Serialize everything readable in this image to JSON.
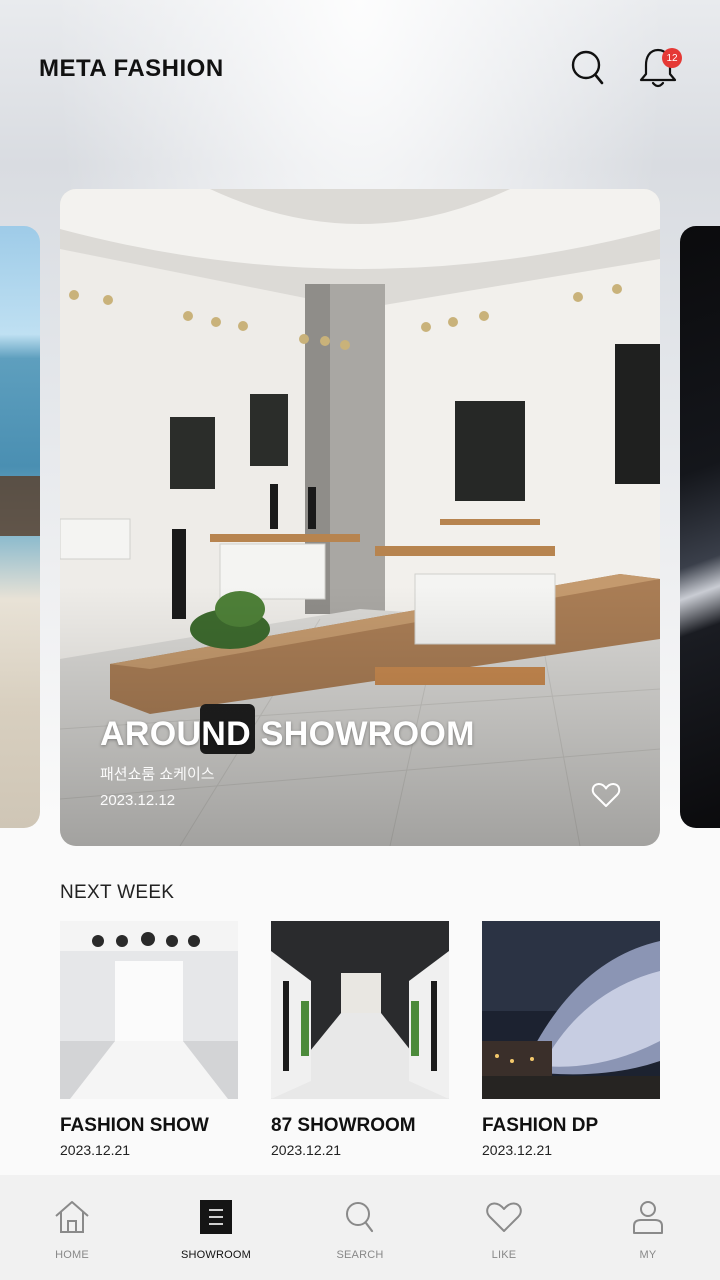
{
  "header": {
    "logo": "META FASHION",
    "notification_count": "12",
    "icons": [
      "search-icon",
      "bell-icon"
    ]
  },
  "featured": {
    "title": "AROUND SHOWROOM",
    "subtitle": "패션쇼룸 쇼케이스",
    "date": "2023.12.12",
    "like_icon": "heart-outline-icon"
  },
  "next_week": {
    "section_title": "NEXT WEEK",
    "items": [
      {
        "title": "FASHION SHOW",
        "date": "2023.12.21"
      },
      {
        "title": "87 SHOWROOM",
        "date": "2023.12.21"
      },
      {
        "title": "FASHION DP",
        "date": "2023.12.21"
      }
    ]
  },
  "nav": {
    "items": [
      {
        "label": "HOME",
        "icon": "home-icon"
      },
      {
        "label": "SHOWROOM",
        "icon": "showroom-icon"
      },
      {
        "label": "SEARCH",
        "icon": "search-icon"
      },
      {
        "label": "LIKE",
        "icon": "heart-icon"
      },
      {
        "label": "MY",
        "icon": "user-icon"
      }
    ],
    "active": "SHOWROOM"
  },
  "colors": {
    "badge": "#e53935",
    "nav_background": "#f1f1f1",
    "active_label": "#111111",
    "inactive_label": "#888888"
  }
}
